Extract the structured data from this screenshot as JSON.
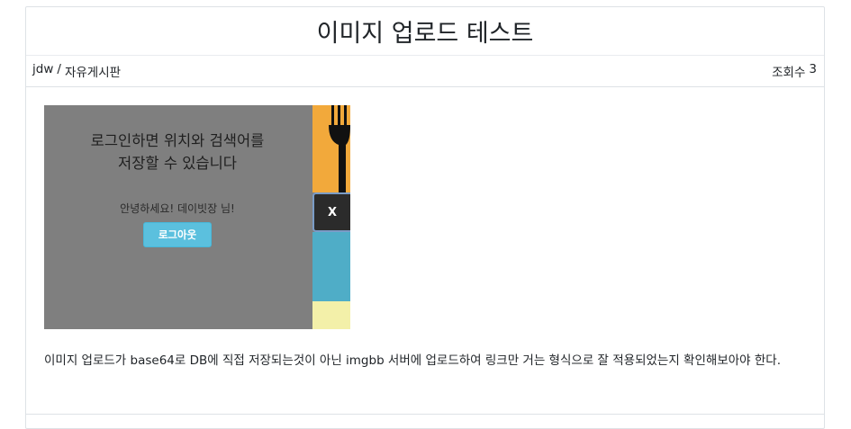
{
  "post": {
    "title": "이미지 업로드 테스트",
    "author": "jdw",
    "separator": "/",
    "board": "자유게시판",
    "views_label": "조회수",
    "views": "3",
    "content": "이미지 업로드가 base64로 DB에 직접 저장되는것이 아닌 imgbb 서버에 업로드하여 링크만 거는 형식으로 잘 적용되었는지 확인해보아야 한다."
  },
  "embedded_image": {
    "message_line1": "로그인하면 위치와 검색어를",
    "message_line2": "저장할 수 있습니다",
    "greeting": "안녕하세요! 데이빗장 님!",
    "logout_label": "로그아웃",
    "close_label": "X",
    "icons": [
      "fork-icon"
    ],
    "colors": {
      "overlay": "#7f7f7f",
      "orange": "#f2a93b",
      "blue": "#4fadc7",
      "yellow": "#f3f0a9",
      "logout": "#5bc0de"
    }
  }
}
